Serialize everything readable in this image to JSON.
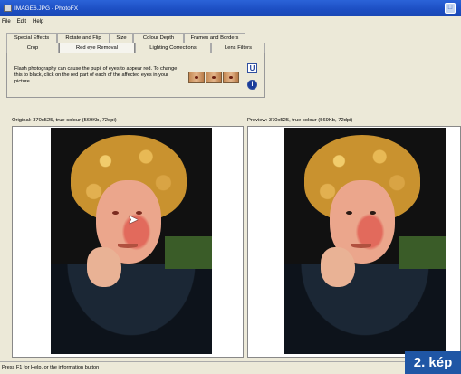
{
  "window": {
    "title": "IMAGE6.JPG - PhotoFX",
    "close_glyph": "□"
  },
  "menu": [
    "File",
    "Edit",
    "Help"
  ],
  "tabs": {
    "row1": [
      "Special Effects",
      "Rotate and Flip",
      "Size",
      "Colour Depth",
      "Frames and Borders"
    ],
    "row2": [
      "Crop",
      "Red eye Removal",
      "Lighting Corrections",
      "Lens Filters"
    ],
    "active": "Red eye Removal"
  },
  "panel": {
    "instructions": "Flash photography can cause the pupil of eyes to appear red. To change this to black, click on the red part of each of the affected eyes in your picture",
    "undo_label": "U",
    "info_label": "i"
  },
  "original": {
    "label": "Original: 370x525, true colour (569Kb, 72dpi)"
  },
  "preview": {
    "label": "Preview: 370x525, true colour (569Kb, 72dpi)"
  },
  "status": {
    "text": "Press F1 for Help, or the information button"
  },
  "badge": {
    "text": "2. kép"
  },
  "colors": {
    "titlebar": "#1c4ec2",
    "badge": "#1f56a5",
    "window_bg": "#ece9d8"
  }
}
